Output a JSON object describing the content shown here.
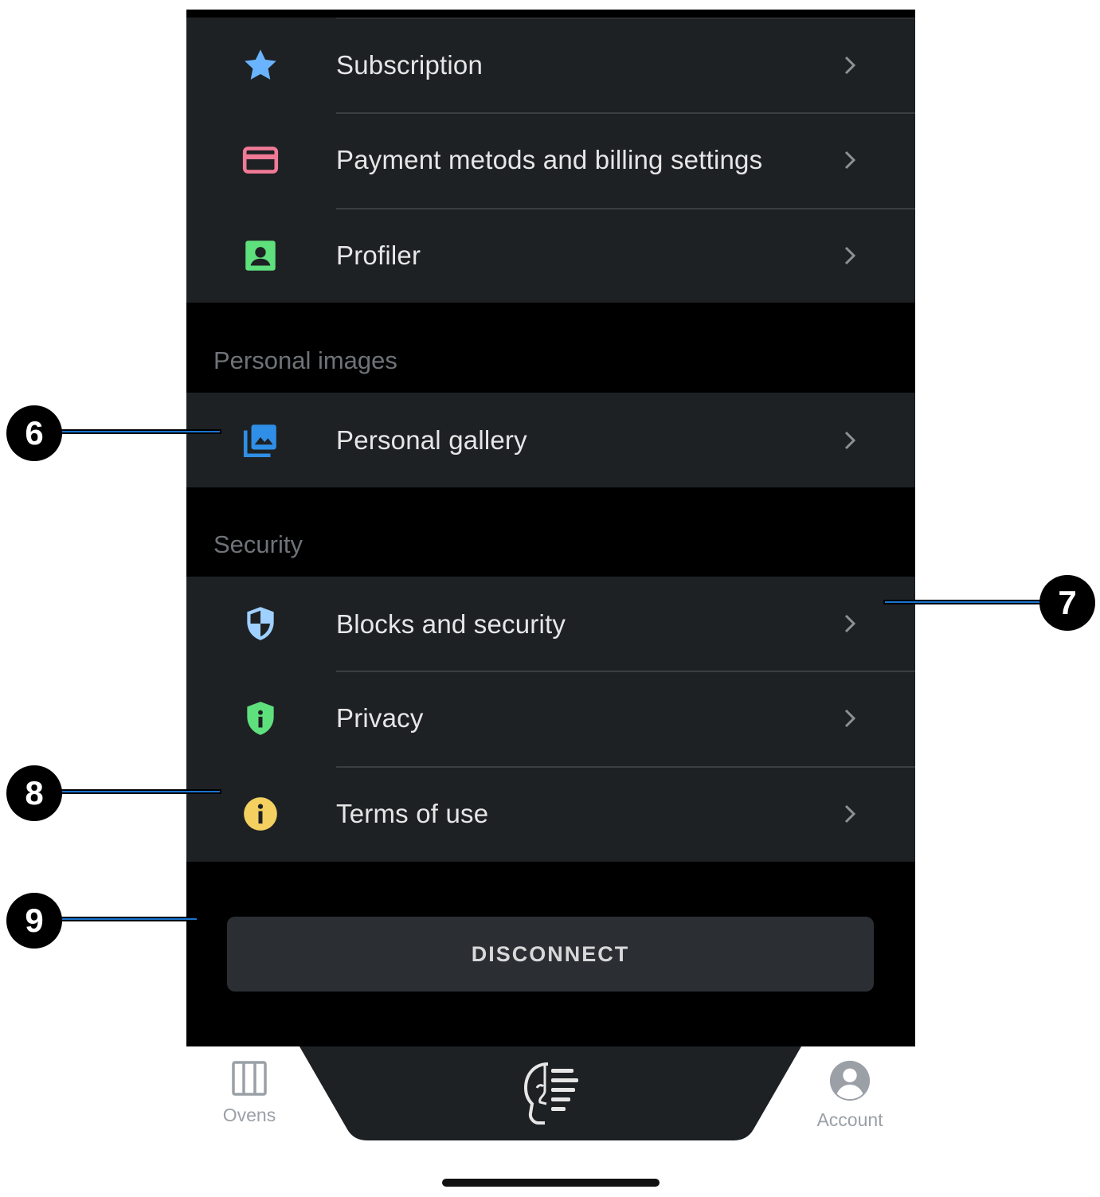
{
  "account_menu": {
    "items_top": [
      {
        "label": "Subscription",
        "icon": "star-icon",
        "icon_color": "#6ab4ff"
      },
      {
        "label": "Payment metods and billing settings",
        "icon": "credit-card-icon",
        "icon_color": "#f07a96"
      },
      {
        "label": "Profiler",
        "icon": "profile-badge-icon",
        "icon_color": "#5ee07c"
      }
    ],
    "personal_images": {
      "header": "Personal images",
      "items": [
        {
          "label": "Personal gallery",
          "icon": "gallery-icon",
          "icon_color": "#2f8fe6"
        }
      ]
    },
    "security": {
      "header": "Security",
      "items": [
        {
          "label": "Blocks and security",
          "icon": "shield-icon",
          "icon_color": "#9fd0ff"
        },
        {
          "label": "Privacy",
          "icon": "privacy-shield-icon",
          "icon_color": "#5ee07c"
        },
        {
          "label": "Terms of use",
          "icon": "info-icon",
          "icon_color": "#f3d060"
        }
      ]
    },
    "disconnect_label": "DISCONNECT"
  },
  "tabbar": {
    "left": {
      "label": "Ovens",
      "icon": "ovens-icon"
    },
    "center": {
      "icon": "app-logo-icon"
    },
    "right": {
      "label": "Account",
      "icon": "account-icon"
    }
  },
  "callouts": [
    "6",
    "7",
    "8",
    "9"
  ],
  "colors": {
    "background": "#000000",
    "row_background": "#1e2124",
    "text": "#e6e6e6",
    "section_header": "#6e7378",
    "callout_line": "#1a74d0"
  }
}
